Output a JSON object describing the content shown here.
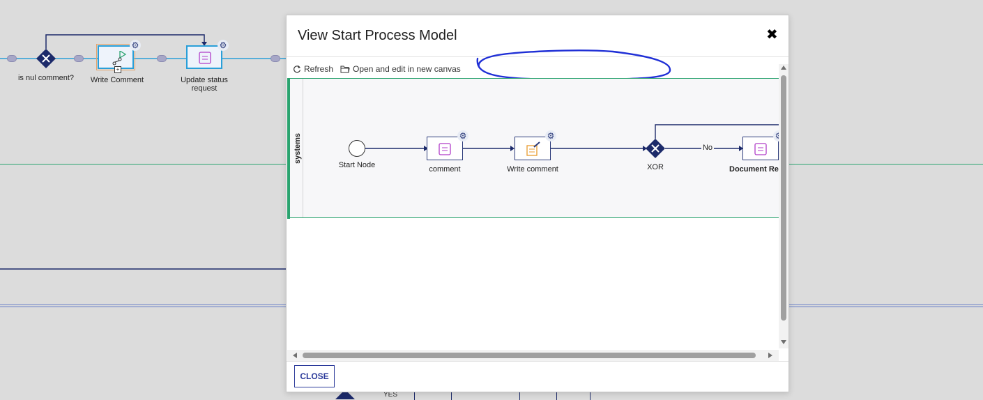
{
  "background": {
    "nodes": {
      "gateway_label": "is nul comment?",
      "write_comment_label": "Write Comment",
      "update_status_label": "Update status request"
    },
    "bottom_fragment_text": "YES"
  },
  "modal": {
    "title": "View Start Process Model",
    "toolbar": {
      "refresh_label": "Refresh",
      "open_label": "Open and edit in new canvas"
    },
    "lane": {
      "label": "systems"
    },
    "diagram": {
      "start_label": "Start Node",
      "comment_label": "comment",
      "write_comment_label": "Write comment",
      "xor_label": "XOR",
      "edge_label": "No",
      "document_label": "Document Req"
    },
    "close_label": "CLOSE"
  },
  "colors": {
    "accent": "#2b3a7a",
    "lane_green": "#2aa36f",
    "node_blue": "#2a9fd8",
    "script_purple": "#b03cc8",
    "form_orange": "#e89a2c",
    "annotation_blue": "#1f2fd6"
  }
}
